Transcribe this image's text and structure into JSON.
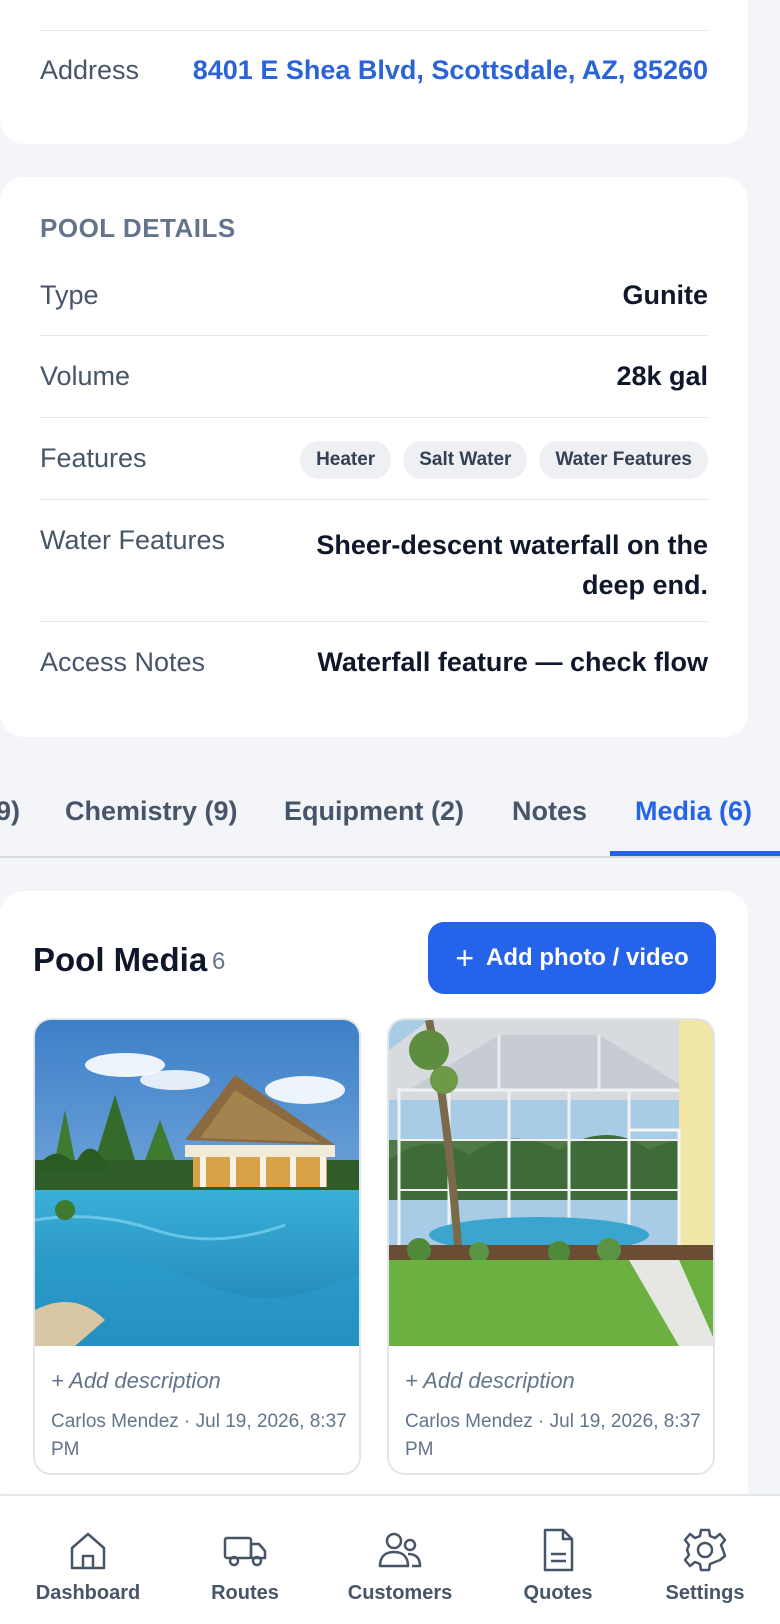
{
  "contact": {
    "address_label": "Address",
    "address_value": "8401 E Shea Blvd, Scottsdale, AZ, 85260"
  },
  "pool_details": {
    "title": "POOL DETAILS",
    "type_label": "Type",
    "type_value": "Gunite",
    "volume_label": "Volume",
    "volume_value": "28k gal",
    "features_label": "Features",
    "features": [
      "Heater",
      "Salt Water",
      "Water Features"
    ],
    "water_features_label": "Water Features",
    "water_features_line1": "Sheer-descent waterfall on the",
    "water_features_line2": "deep end.",
    "access_notes_label": "Access Notes",
    "access_notes_value": "Waterfall feature — check flow"
  },
  "tabs": {
    "partial": "9)",
    "chemistry": "Chemistry (9)",
    "equipment": "Equipment (2)",
    "notes": "Notes",
    "media": "Media (6)",
    "active": "media"
  },
  "media": {
    "title": "Pool Media",
    "count": "6",
    "add_button": "Add photo / video",
    "items": [
      {
        "description": "+ Add description",
        "meta": "Carlos Mendez · Jul 19, 2026, 8:37 PM"
      },
      {
        "description": "+ Add description",
        "meta": "Carlos Mendez · Jul 19, 2026, 8:37 PM"
      }
    ]
  },
  "nav": {
    "dashboard": "Dashboard",
    "routes": "Routes",
    "customers": "Customers",
    "quotes": "Quotes",
    "settings": "Settings"
  },
  "colors": {
    "accent": "#2563eb",
    "link": "#2b63d9",
    "background": "#f3f5f8"
  }
}
